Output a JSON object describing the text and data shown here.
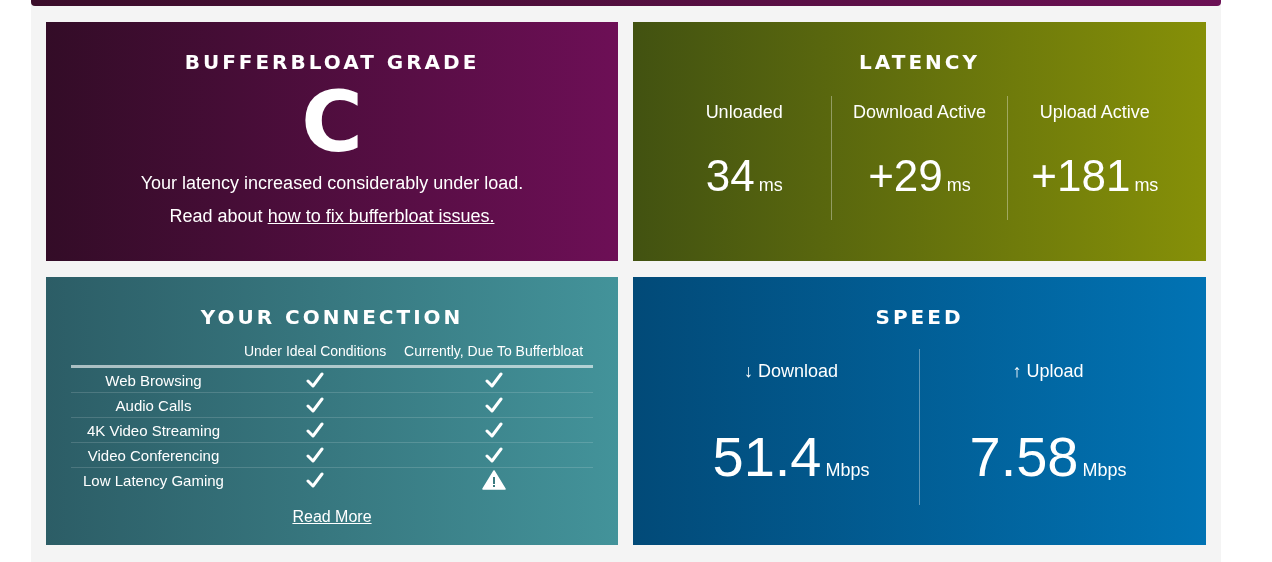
{
  "grade": {
    "title": "BUFFERBLOAT GRADE",
    "grade": "C",
    "summary": "Your latency increased considerably under load.",
    "read_prefix": "Read about",
    "link": "how to fix bufferbloat issues."
  },
  "latency": {
    "title": "LATENCY",
    "items": [
      {
        "label": "Unloaded",
        "value": "34",
        "unit": "ms"
      },
      {
        "label": "Download Active",
        "value": "+29",
        "unit": "ms"
      },
      {
        "label": "Upload Active",
        "value": "+181",
        "unit": "ms"
      }
    ]
  },
  "connection": {
    "title": "YOUR CONNECTION",
    "columns": [
      "Under Ideal Conditions",
      "Currently, Due To Bufferbloat"
    ],
    "rows": [
      {
        "name": "Web Browsing",
        "ideal_ok": true,
        "current_ok": true
      },
      {
        "name": "Audio Calls",
        "ideal_ok": true,
        "current_ok": true
      },
      {
        "name": "4K Video Streaming",
        "ideal_ok": true,
        "current_ok": true
      },
      {
        "name": "Video Conferencing",
        "ideal_ok": true,
        "current_ok": true
      },
      {
        "name": "Low Latency Gaming",
        "ideal_ok": true,
        "current_ok": false
      }
    ],
    "link": "Read More"
  },
  "speed": {
    "title": "SPEED",
    "items": [
      {
        "label": "↓ Download",
        "value": "51.4",
        "unit": "Mbps"
      },
      {
        "label": "↑ Upload",
        "value": "7.58",
        "unit": "Mbps"
      }
    ]
  }
}
